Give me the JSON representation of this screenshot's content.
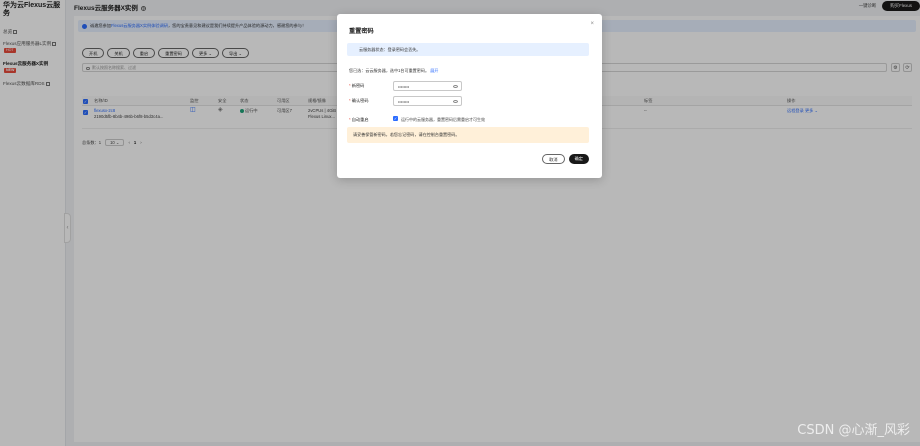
{
  "sidebar": {
    "brand": "华为云Flexus云服务",
    "items": [
      {
        "label": "总览"
      },
      {
        "label": "Flexus应用服务器L实例",
        "badge": "HOT"
      },
      {
        "label": "Flexus云服务器X实例",
        "badge": "NEW"
      },
      {
        "label": "Flexus云数据库RDS"
      }
    ],
    "collapse": "‹"
  },
  "header": {
    "title": "Flexus云服务器X实例",
    "help": "?",
    "quick_link": "一键诊断",
    "buy_button": "购买Flexus"
  },
  "banner": {
    "prefix": "诚邀您参加",
    "link": "Flexus云服务器X实例体验调研",
    "suffix": "，您的宝贵意见和建议是我们持续提升产品体验的源动力，感谢您的参与！"
  },
  "toolbar": {
    "buttons": [
      "开机",
      "关机",
      "重启",
      "重置密码",
      "更多 ⌄",
      "导出 ⌄"
    ]
  },
  "search": {
    "placeholder": "默认按照名称搜索、过滤",
    "settings_icon": "⚙",
    "refresh_icon": "⟳"
  },
  "table": {
    "columns": [
      "名称/ID",
      "监控",
      "安全",
      "状态",
      "可用区",
      "规格/镜像",
      "标签",
      "操作"
    ],
    "rows": [
      {
        "name": "flexusx-2c8",
        "id": "2190d5fb-8b4b-496b-b6f8-b5d3c4a...",
        "status": "运行中",
        "zone": "可用区7",
        "spec": "2vCPUs | 4GiB",
        "image": "Flexus Linux...",
        "tags": "--",
        "action_login": "远程登录",
        "action_more": "更多 ⌄"
      }
    ]
  },
  "pagination": {
    "total_label": "总条数：1",
    "page_size": "10 ⌄",
    "prev": "‹",
    "page": "1",
    "next": "›"
  },
  "modal": {
    "title": "重置密码",
    "close": "×",
    "note": "云服务器状态：登录密码会丢失。",
    "intro": "您已选：云云服务器，选中1台可重置密码。",
    "intro_link": "展开",
    "new_password_label": "新密码",
    "new_password_value": "••••••••",
    "confirm_password_label": "确认密码",
    "confirm_password_value": "••••••••",
    "auto_restart_label": "自动重启",
    "auto_restart_text": "运行中的云服务器，重置密码后需重启才可生效",
    "warning": "请妥善保管新密码，若您忘记密码，请在控制台重置密码。",
    "cancel": "取消",
    "ok": "确定"
  },
  "watermark": "CSDN @心渐_风彩"
}
